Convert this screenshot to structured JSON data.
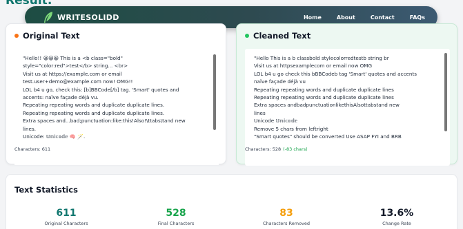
{
  "page": {
    "heading": "Result:"
  },
  "navbar": {
    "brand": "WRITESOLIDD",
    "links": [
      "Home",
      "About",
      "Contact",
      "FAQs"
    ]
  },
  "original": {
    "title": "Original Text",
    "dot_color": "#f97316",
    "lines": [
      "\"Hello!! 😀😀😀   This    is a <b class=\"bold\"",
      "style=\"color:red\">test</b> string... <br>",
      "   Visit us at https://example.com or email",
      "test.user+demo@example.com now! OMG!!",
      "   LOL   b4   u   go, check this: [b]BBCode[/b] tag. 'Smart' quotes and",
      "accents: naïve façade déjà vu.",
      "   Repeating repeating words and duplicate duplicate lines.",
      "   Repeating repeating words and duplicate duplicate lines.",
      "   Extra     spaces    and...bad;punctuation:like:this!Also!\\ttabs\\tand new",
      "lines.",
      "   Unicode: 𝕌𝕟𝕚𝕔𝕠𝕕𝕖 🧠 🪄."
    ],
    "char_count": "Characters: 611"
  },
  "cleaned": {
    "title": "Cleaned Text",
    "dot_color": "#22c55e",
    "lines": [
      "\"Hello    This    is a b classbold stylecolorredtestb string br",
      "   Visit us at httpsexamplecom or email  now OMG",
      "   LOL   b4   u   go check this bBBCodeb tag 'Smart' quotes and accents",
      "naïve façade déjà vu",
      "   Repeating repeating words and duplicate duplicate lines",
      "   Repeating repeating words and duplicate duplicate lines",
      "   Extra     spaces     andbadpunctuationlikethisAlsottabstand new",
      "lines",
      "   Unicode 𝕌𝕟𝕚𝕔𝕠𝕕𝕖",
      "   Remove 5 chars from leftright",
      "   \"Smart quotes\" should be converted Use ASAP FYI and BRB"
    ],
    "char_count": "Characters: 528",
    "char_diff": "(-83 chars)"
  },
  "stats": {
    "title": "Text Statistics",
    "items": [
      {
        "value": "611",
        "label": "Original Characters",
        "color": "#0f766e"
      },
      {
        "value": "528",
        "label": "Final Characters",
        "color": "#16a34a"
      },
      {
        "value": "83",
        "label": "Characters Removed",
        "color": "#f59e0b"
      },
      {
        "value": "13.6%",
        "label": "Change Rate",
        "color": "#111827"
      }
    ]
  }
}
